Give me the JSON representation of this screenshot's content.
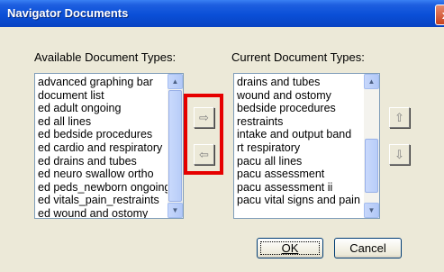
{
  "window": {
    "title": "Navigator Documents",
    "close_glyph": "x"
  },
  "available": {
    "label": "Available Document Types:",
    "items": [
      "advanced graphing bar",
      "document list",
      "ed adult ongoing",
      "ed all lines",
      "ed bedside procedures",
      "ed cardio and respiratory",
      "ed drains and tubes",
      "ed neuro swallow ortho",
      "ed peds_newborn ongoing",
      "ed vitals_pain_restraints",
      "ed wound and ostomy"
    ]
  },
  "current": {
    "label": "Current Document Types:",
    "items": [
      "drains and tubes",
      "wound and ostomy",
      "bedside procedures",
      "restraints",
      "intake and output band",
      "rt respiratory",
      "pacu all lines",
      "pacu assessment",
      "pacu assessment ii",
      "pacu vital signs and pain"
    ]
  },
  "buttons": {
    "ok": "OK",
    "cancel": "Cancel"
  },
  "icons": {
    "add": "⇨",
    "remove": "⇦",
    "move_up": "⇧",
    "move_down": "⇩",
    "scroll_up": "▲",
    "scroll_down": "▼"
  },
  "colors": {
    "highlight": "#e60000",
    "titlebar": "#0a4fd7"
  }
}
